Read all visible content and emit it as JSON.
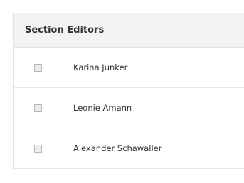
{
  "section": {
    "title": "Section Editors",
    "editors": [
      {
        "name": "Karina Junker",
        "checked": false
      },
      {
        "name": "Leonie Amann",
        "checked": false
      },
      {
        "name": "Alexander Schawaller",
        "checked": false
      }
    ]
  },
  "colors": {
    "header_bg": "#f3f3f3",
    "border": "#e1e1e1",
    "text": "#333333"
  }
}
